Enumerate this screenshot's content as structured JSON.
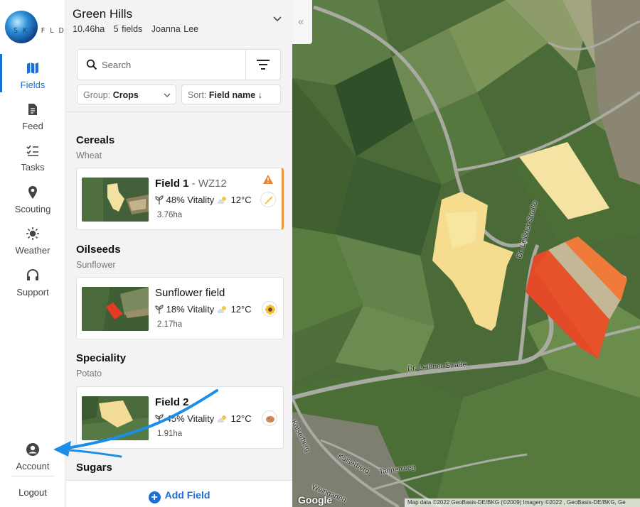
{
  "logo": {
    "text": "SKYFLD"
  },
  "nav": {
    "items": [
      {
        "label": "Fields",
        "icon": "map-icon",
        "active": true
      },
      {
        "label": "Feed",
        "icon": "feed-icon"
      },
      {
        "label": "Tasks",
        "icon": "tasks-icon"
      },
      {
        "label": "Scouting",
        "icon": "location-pin-icon"
      },
      {
        "label": "Weather",
        "icon": "sun-icon"
      },
      {
        "label": "Support",
        "icon": "headset-icon"
      }
    ],
    "account_label": "Account",
    "logout_label": "Logout"
  },
  "farm": {
    "name": "Green Hills",
    "area": "10.46ha",
    "fields": "5 fields",
    "owner": "Joanna Lee"
  },
  "search": {
    "placeholder": "Search"
  },
  "group_dropdown": {
    "key": "Group:",
    "value": "Crops"
  },
  "sort_dropdown": {
    "key": "Sort:",
    "value": "Field name",
    "arrow": "↓"
  },
  "groups": [
    {
      "title": "Cereals",
      "subtitle": "Wheat",
      "card": {
        "name": "Field 1",
        "crop_code": "- WZ12",
        "vitality": "48% Vitality",
        "temp": "12°C",
        "area": "3.76ha",
        "warning": true,
        "badge_icon": "wheat-icon"
      }
    },
    {
      "title": "Oilseeds",
      "subtitle": "Sunflower",
      "card": {
        "name": "Sunflower field",
        "crop_code": "",
        "vitality": "18% Vitality",
        "temp": "12°C",
        "area": "2.17ha",
        "warning": false,
        "badge_icon": "sunflower-icon"
      }
    },
    {
      "title": "Speciality",
      "subtitle": "Potato",
      "card": {
        "name": "Field 2",
        "crop_code": "",
        "vitality": "45% Vitality",
        "temp": "12°C",
        "area": "1.91ha",
        "warning": false,
        "badge_icon": "potato-icon"
      }
    },
    {
      "title": "Sugars"
    }
  ],
  "add_field_label": "Add Field",
  "map": {
    "road_labels": [
      "Dr.-Leißner-Straße",
      "Dr.-Leißner-Straße",
      "Kaiserberg",
      "Tannenweg",
      "Weingarten",
      "Kaiserberg"
    ],
    "watermark": "Google",
    "attribution": "Map data ©2022 GeoBasis-DE/BKG (©2009) Imagery ©2022 , GeoBasis-DE/BKG, Ge"
  },
  "colors": {
    "accent": "#1a6fd6",
    "selected_border": "#f0963a",
    "warning": "#f0822a",
    "pin": "#7a1fa6"
  }
}
